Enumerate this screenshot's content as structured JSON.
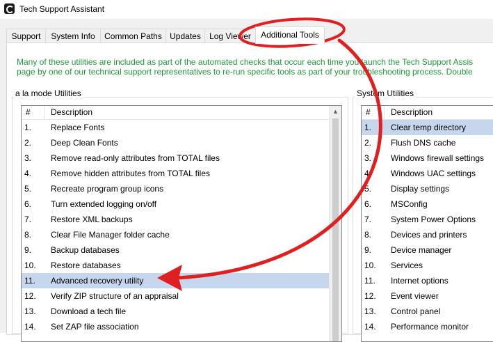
{
  "window": {
    "title": "Tech Support Assistant"
  },
  "tabs": [
    {
      "label": "Support"
    },
    {
      "label": "System Info"
    },
    {
      "label": "Common Paths"
    },
    {
      "label": "Updates"
    },
    {
      "label": "Log Viewer"
    },
    {
      "label": "Additional Tools",
      "active": true
    }
  ],
  "intro": {
    "line1": "Many of these utilities are included as part of the automated checks that occur each time you launch the Tech Support Assis",
    "line2": "page by one of our technical support representatives to re-run specific tools as part of your troubleshooting process.  Double"
  },
  "alamode": {
    "group_label": "a la mode Utilities",
    "header_num": "#",
    "header_desc": "Description",
    "items": [
      {
        "num": "1.",
        "desc": "Replace Fonts"
      },
      {
        "num": "2.",
        "desc": "Deep Clean Fonts"
      },
      {
        "num": "3.",
        "desc": "Remove read-only attributes from TOTAL files"
      },
      {
        "num": "4.",
        "desc": "Remove hidden attributes from TOTAL files"
      },
      {
        "num": "5.",
        "desc": "Recreate program group icons"
      },
      {
        "num": "6.",
        "desc": "Turn extended logging on/off"
      },
      {
        "num": "7.",
        "desc": "Restore XML backups"
      },
      {
        "num": "8.",
        "desc": "Clear File Manager folder cache"
      },
      {
        "num": "9.",
        "desc": "Backup databases"
      },
      {
        "num": "10.",
        "desc": "Restore databases"
      },
      {
        "num": "11.",
        "desc": "Advanced recovery utility"
      },
      {
        "num": "12.",
        "desc": "Verify ZIP structure of an appraisal"
      },
      {
        "num": "13.",
        "desc": "Download a tech file"
      },
      {
        "num": "14.",
        "desc": "Set ZAP file association"
      }
    ],
    "selected_index": 10
  },
  "system": {
    "group_label": "System Utilities",
    "header_num": "#",
    "header_desc": "Description",
    "items": [
      {
        "num": "1.",
        "desc": "Clear temp directory"
      },
      {
        "num": "2.",
        "desc": "Flush DNS cache"
      },
      {
        "num": "3.",
        "desc": "Windows firewall settings"
      },
      {
        "num": "4.",
        "desc": "Windows UAC settings"
      },
      {
        "num": "5.",
        "desc": "Display settings"
      },
      {
        "num": "6.",
        "desc": "MSConfig"
      },
      {
        "num": "7.",
        "desc": "System Power Options"
      },
      {
        "num": "8.",
        "desc": "Devices and printers"
      },
      {
        "num": "9.",
        "desc": "Device manager"
      },
      {
        "num": "10.",
        "desc": "Services"
      },
      {
        "num": "11.",
        "desc": "Internet options"
      },
      {
        "num": "12.",
        "desc": "Event viewer"
      },
      {
        "num": "13.",
        "desc": "Control panel"
      },
      {
        "num": "14.",
        "desc": "Performance monitor"
      }
    ],
    "selected_index": 0
  },
  "annotation": {
    "color": "#e02020"
  }
}
